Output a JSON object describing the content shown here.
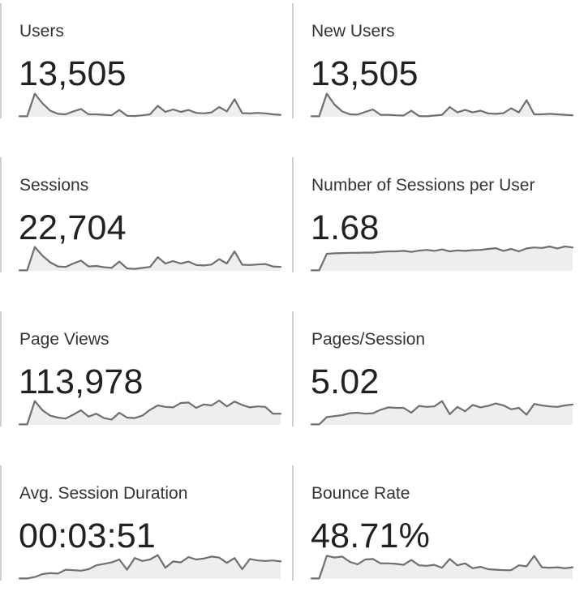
{
  "colors": {
    "line": "#6f6f6f",
    "area": "#eeeeee",
    "divider": "#cfcfcf",
    "text": "#212121"
  },
  "metrics": [
    {
      "label": "Users",
      "value": "13,505",
      "spark": [
        0.02,
        0.02,
        0.95,
        0.55,
        0.25,
        0.12,
        0.1,
        0.22,
        0.32,
        0.1,
        0.1,
        0.08,
        0.06,
        0.28,
        0.04,
        0.03,
        0.06,
        0.1,
        0.45,
        0.2,
        0.3,
        0.2,
        0.28,
        0.16,
        0.14,
        0.18,
        0.4,
        0.22,
        0.72,
        0.15,
        0.14,
        0.16,
        0.14,
        0.1,
        0.08
      ]
    },
    {
      "label": "New Users",
      "value": "13,505",
      "spark": [
        0.02,
        0.02,
        0.95,
        0.5,
        0.22,
        0.1,
        0.09,
        0.2,
        0.3,
        0.08,
        0.08,
        0.06,
        0.05,
        0.25,
        0.03,
        0.02,
        0.05,
        0.08,
        0.4,
        0.18,
        0.28,
        0.18,
        0.25,
        0.14,
        0.12,
        0.15,
        0.35,
        0.18,
        0.68,
        0.1,
        0.1,
        0.12,
        0.1,
        0.08,
        0.06
      ]
    },
    {
      "label": "Sessions",
      "value": "22,704",
      "spark": [
        0.02,
        0.02,
        0.98,
        0.62,
        0.35,
        0.18,
        0.16,
        0.3,
        0.42,
        0.18,
        0.2,
        0.15,
        0.12,
        0.38,
        0.1,
        0.08,
        0.12,
        0.16,
        0.56,
        0.3,
        0.4,
        0.3,
        0.38,
        0.24,
        0.22,
        0.26,
        0.48,
        0.3,
        0.8,
        0.25,
        0.24,
        0.26,
        0.28,
        0.18,
        0.16
      ]
    },
    {
      "label": "Number of Sessions per User",
      "value": "1.68",
      "spark": [
        0.02,
        0.02,
        0.7,
        0.72,
        0.73,
        0.74,
        0.74,
        0.75,
        0.75,
        0.78,
        0.8,
        0.8,
        0.82,
        0.78,
        0.83,
        0.86,
        0.82,
        0.88,
        0.8,
        0.84,
        0.82,
        0.85,
        0.86,
        0.9,
        0.93,
        0.82,
        0.9,
        0.8,
        0.92,
        0.96,
        0.94,
        1.0,
        0.92,
        1.0,
        0.96
      ]
    },
    {
      "label": "Page Views",
      "value": "113,978",
      "spark": [
        0.02,
        0.02,
        0.98,
        0.6,
        0.38,
        0.3,
        0.26,
        0.42,
        0.6,
        0.34,
        0.46,
        0.28,
        0.22,
        0.5,
        0.3,
        0.28,
        0.38,
        0.62,
        0.8,
        0.74,
        0.72,
        0.9,
        0.92,
        0.7,
        0.84,
        0.8,
        1.0,
        0.76,
        0.96,
        0.82,
        0.72,
        0.76,
        0.74,
        0.46,
        0.46
      ]
    },
    {
      "label": "Pages/Session",
      "value": "5.02",
      "spark": [
        0.02,
        0.02,
        0.32,
        0.36,
        0.4,
        0.48,
        0.5,
        0.46,
        0.48,
        0.62,
        0.72,
        0.7,
        0.7,
        0.5,
        0.78,
        0.74,
        0.76,
        0.98,
        0.44,
        0.74,
        0.56,
        0.82,
        0.72,
        0.78,
        0.88,
        0.8,
        0.64,
        0.7,
        0.42,
        0.86,
        0.8,
        0.76,
        0.74,
        0.8,
        0.84
      ]
    },
    {
      "label": "Avg. Session Duration",
      "value": "00:03:51",
      "spark": [
        0.02,
        0.02,
        0.08,
        0.2,
        0.24,
        0.22,
        0.38,
        0.36,
        0.34,
        0.4,
        0.56,
        0.62,
        0.68,
        0.8,
        0.38,
        0.86,
        0.74,
        0.8,
        0.98,
        0.46,
        0.72,
        0.68,
        0.9,
        0.8,
        0.84,
        0.92,
        0.88,
        0.66,
        0.86,
        0.4,
        0.82,
        0.76,
        0.74,
        0.76,
        0.72
      ]
    },
    {
      "label": "Bounce Rate",
      "value": "48.71%",
      "spark": [
        0.02,
        0.02,
        0.95,
        0.88,
        0.92,
        0.7,
        0.6,
        0.8,
        0.82,
        0.64,
        0.64,
        0.62,
        0.58,
        0.78,
        0.56,
        0.54,
        0.58,
        0.46,
        0.82,
        0.56,
        0.64,
        0.44,
        0.5,
        0.4,
        0.38,
        0.36,
        0.36,
        0.56,
        0.52,
        0.95,
        0.48,
        0.46,
        0.48,
        0.44,
        0.48
      ]
    }
  ]
}
